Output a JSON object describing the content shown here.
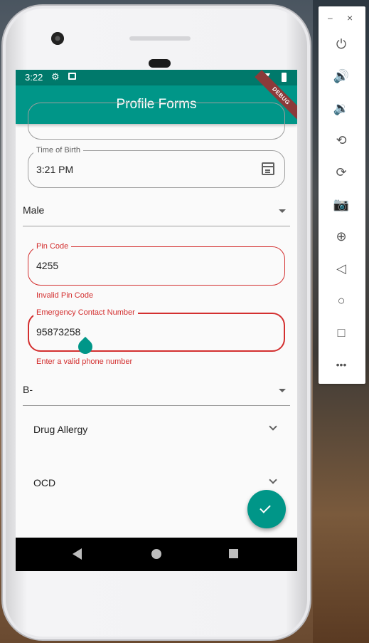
{
  "status_bar": {
    "time": "3:22",
    "settings_icon": "gear-icon",
    "image_icon": "image-icon",
    "wifi_icon": "wifi-icon",
    "battery_icon": "battery-icon"
  },
  "app_bar": {
    "title": "Profile Forms",
    "debug_banner": "DEBUG"
  },
  "form": {
    "time_of_birth": {
      "label": "Time of Birth",
      "value": "3:21 PM",
      "icon": "calendar-icon"
    },
    "gender": {
      "value": "Male"
    },
    "pin_code": {
      "label": "Pin Code",
      "value": "4255",
      "error": "Invalid Pin Code"
    },
    "emergency_contact": {
      "label": "Emergency Contact Number",
      "value": "95873258",
      "error": "Enter a valid phone number"
    },
    "blood_group": {
      "value": "B-"
    },
    "expansions": [
      {
        "label": "Drug Allergy"
      },
      {
        "label": "OCD"
      }
    ]
  },
  "fab": {
    "icon": "check-icon"
  },
  "nav_bar": {
    "back_icon": "back-icon",
    "home_icon": "home-icon",
    "recents_icon": "recents-icon"
  },
  "emulator_toolbar": {
    "minimize": "–",
    "close": "×",
    "buttons": [
      {
        "name": "power-icon",
        "glyph": "⏻"
      },
      {
        "name": "volume-up-icon",
        "glyph": "🔊"
      },
      {
        "name": "volume-down-icon",
        "glyph": "🔉"
      },
      {
        "name": "rotate-left-icon",
        "glyph": "⟲"
      },
      {
        "name": "rotate-right-icon",
        "glyph": "⟳"
      },
      {
        "name": "camera-icon",
        "glyph": "📷"
      },
      {
        "name": "zoom-icon",
        "glyph": "⊕"
      },
      {
        "name": "back-icon",
        "glyph": "◁"
      },
      {
        "name": "home-icon",
        "glyph": "○"
      },
      {
        "name": "overview-icon",
        "glyph": "□"
      },
      {
        "name": "more-icon",
        "glyph": "•••"
      }
    ]
  },
  "colors": {
    "primary": "#009688",
    "primary_dark": "#00796b",
    "error": "#d32f2f"
  }
}
